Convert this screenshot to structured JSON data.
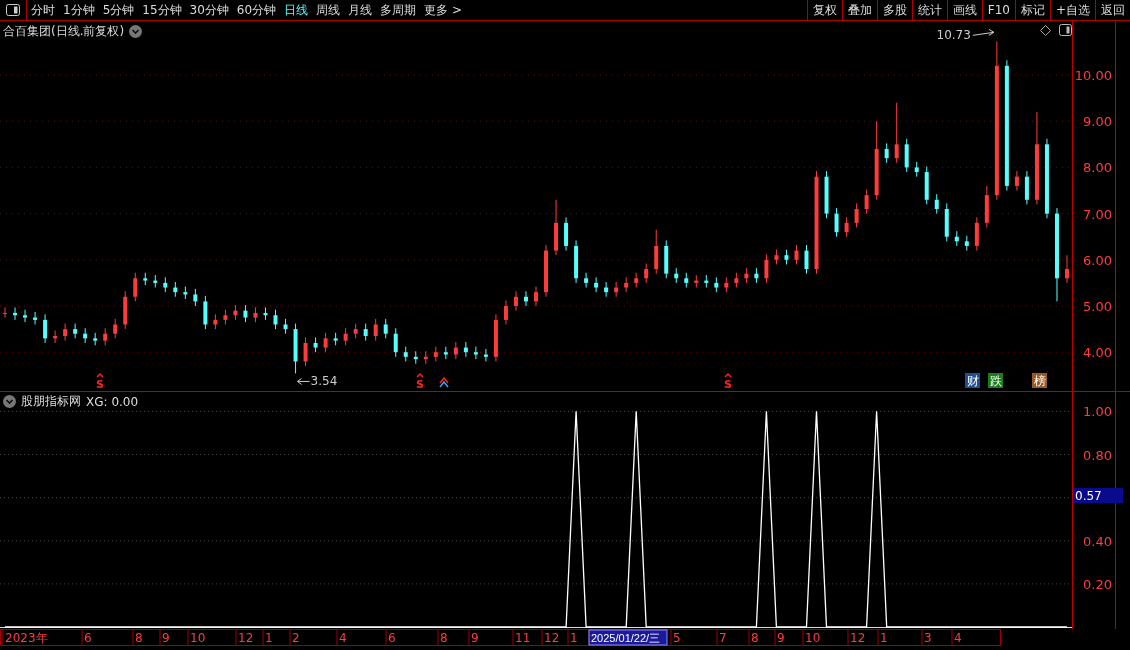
{
  "toolbar": {
    "periods": [
      {
        "label": "分时",
        "selected": false
      },
      {
        "label": "1分钟",
        "selected": false
      },
      {
        "label": "5分钟",
        "selected": false
      },
      {
        "label": "15分钟",
        "selected": false
      },
      {
        "label": "30分钟",
        "selected": false
      },
      {
        "label": "60分钟",
        "selected": false
      },
      {
        "label": "日线",
        "selected": true
      },
      {
        "label": "周线",
        "selected": false
      },
      {
        "label": "月线",
        "selected": false
      },
      {
        "label": "多周期",
        "selected": false
      },
      {
        "label": "更多 >",
        "selected": false
      }
    ],
    "buttons": [
      "复权",
      "叠加",
      "多股",
      "统计",
      "画线",
      "F10",
      "标记",
      "+自选",
      "返回"
    ]
  },
  "price_panel": {
    "title": "合百集团(日线.前复权)",
    "high_label": "10.73",
    "low_label": "3.54",
    "signals": [
      {
        "kind": "sell",
        "text": "S"
      },
      {
        "kind": "sell",
        "text": "S"
      },
      {
        "kind": "buy"
      },
      {
        "kind": "sell",
        "text": "S"
      }
    ],
    "badges": [
      {
        "text": "财",
        "color": "#1d4e8f"
      },
      {
        "text": "跌",
        "color": "#1b7d1b"
      },
      {
        "text": "榜",
        "color": "#9a5a22"
      }
    ],
    "chart_data": {
      "type": "candlestick",
      "grid": true,
      "ylim": [
        3.16,
        11.17
      ],
      "yticks": [
        {
          "value": 4,
          "label": "4.00"
        },
        {
          "value": 5,
          "label": "5.00"
        },
        {
          "value": 6,
          "label": "6.00"
        },
        {
          "value": 7,
          "label": "7.00"
        },
        {
          "value": 8,
          "label": "8.00"
        },
        {
          "value": 9,
          "label": "9.00"
        },
        {
          "value": 10,
          "label": "10.00"
        }
      ],
      "ohlc": [
        [
          4.85,
          4.97,
          4.75,
          4.85
        ],
        [
          4.85,
          4.97,
          4.7,
          4.8
        ],
        [
          4.8,
          4.92,
          4.65,
          4.75
        ],
        [
          4.75,
          4.87,
          4.6,
          4.7
        ],
        [
          4.7,
          4.82,
          4.2,
          4.3
        ],
        [
          4.3,
          4.47,
          4.2,
          4.35
        ],
        [
          4.35,
          4.62,
          4.25,
          4.5
        ],
        [
          4.5,
          4.62,
          4.3,
          4.4
        ],
        [
          4.4,
          4.52,
          4.2,
          4.3
        ],
        [
          4.3,
          4.42,
          4.15,
          4.25
        ],
        [
          4.25,
          4.52,
          4.15,
          4.4
        ],
        [
          4.4,
          4.72,
          4.3,
          4.6
        ],
        [
          4.6,
          5.32,
          4.5,
          5.2
        ],
        [
          5.2,
          5.72,
          5.1,
          5.6
        ],
        [
          5.6,
          5.72,
          5.45,
          5.55
        ],
        [
          5.55,
          5.67,
          5.4,
          5.5
        ],
        [
          5.5,
          5.62,
          5.3,
          5.4
        ],
        [
          5.4,
          5.52,
          5.2,
          5.3
        ],
        [
          5.3,
          5.42,
          5.15,
          5.25
        ],
        [
          5.25,
          5.37,
          5.0,
          5.1
        ],
        [
          5.1,
          5.22,
          4.5,
          4.6
        ],
        [
          4.6,
          4.82,
          4.5,
          4.7
        ],
        [
          4.7,
          4.92,
          4.6,
          4.8
        ],
        [
          4.8,
          5.02,
          4.7,
          4.9
        ],
        [
          4.9,
          5.02,
          4.65,
          4.75
        ],
        [
          4.75,
          4.97,
          4.65,
          4.85
        ],
        [
          4.85,
          4.97,
          4.7,
          4.8
        ],
        [
          4.8,
          4.92,
          4.5,
          4.6
        ],
        [
          4.6,
          4.72,
          4.4,
          4.5
        ],
        [
          4.5,
          4.62,
          3.54,
          3.8
        ],
        [
          3.8,
          4.32,
          3.7,
          4.2
        ],
        [
          4.2,
          4.32,
          4.0,
          4.1
        ],
        [
          4.1,
          4.42,
          4.0,
          4.3
        ],
        [
          4.3,
          4.42,
          4.15,
          4.25
        ],
        [
          4.25,
          4.52,
          4.15,
          4.4
        ],
        [
          4.4,
          4.62,
          4.3,
          4.5
        ],
        [
          4.5,
          4.62,
          4.25,
          4.35
        ],
        [
          4.35,
          4.72,
          4.25,
          4.6
        ],
        [
          4.6,
          4.72,
          4.3,
          4.4
        ],
        [
          4.4,
          4.52,
          3.9,
          4.0
        ],
        [
          4.0,
          4.12,
          3.8,
          3.9
        ],
        [
          3.9,
          4.02,
          3.75,
          3.85
        ],
        [
          3.85,
          4.02,
          3.75,
          3.9
        ],
        [
          3.9,
          4.12,
          3.8,
          4.0
        ],
        [
          4.0,
          4.12,
          3.85,
          3.95
        ],
        [
          3.95,
          4.22,
          3.85,
          4.1
        ],
        [
          4.1,
          4.22,
          3.9,
          4.0
        ],
        [
          4.0,
          4.12,
          3.85,
          3.95
        ],
        [
          3.95,
          4.07,
          3.8,
          3.9
        ],
        [
          3.9,
          4.82,
          3.8,
          4.7
        ],
        [
          4.7,
          5.12,
          4.6,
          5.0
        ],
        [
          5.0,
          5.32,
          4.9,
          5.2
        ],
        [
          5.2,
          5.32,
          5.0,
          5.1
        ],
        [
          5.1,
          5.42,
          5.0,
          5.3
        ],
        [
          5.3,
          6.32,
          5.2,
          6.2
        ],
        [
          6.2,
          7.3,
          6.1,
          6.8
        ],
        [
          6.8,
          6.92,
          6.2,
          6.3
        ],
        [
          6.3,
          6.42,
          5.5,
          5.6
        ],
        [
          5.6,
          5.72,
          5.4,
          5.5
        ],
        [
          5.5,
          5.62,
          5.3,
          5.4
        ],
        [
          5.4,
          5.52,
          5.2,
          5.3
        ],
        [
          5.3,
          5.52,
          5.2,
          5.4
        ],
        [
          5.4,
          5.62,
          5.3,
          5.5
        ],
        [
          5.5,
          5.72,
          5.4,
          5.6
        ],
        [
          5.6,
          5.92,
          5.5,
          5.8
        ],
        [
          5.8,
          6.65,
          5.7,
          6.3
        ],
        [
          6.3,
          6.42,
          5.6,
          5.7
        ],
        [
          5.7,
          5.82,
          5.5,
          5.6
        ],
        [
          5.6,
          5.72,
          5.4,
          5.5
        ],
        [
          5.5,
          5.67,
          5.4,
          5.55
        ],
        [
          5.55,
          5.67,
          5.4,
          5.5
        ],
        [
          5.5,
          5.62,
          5.3,
          5.4
        ],
        [
          5.4,
          5.62,
          5.3,
          5.5
        ],
        [
          5.5,
          5.72,
          5.4,
          5.6
        ],
        [
          5.6,
          5.82,
          5.5,
          5.7
        ],
        [
          5.7,
          5.82,
          5.5,
          5.6
        ],
        [
          5.6,
          6.12,
          5.5,
          6.0
        ],
        [
          6.0,
          6.22,
          5.9,
          6.1
        ],
        [
          6.1,
          6.22,
          5.9,
          6.0
        ],
        [
          6.0,
          6.32,
          5.9,
          6.2
        ],
        [
          6.2,
          6.32,
          5.7,
          5.8
        ],
        [
          5.8,
          7.92,
          5.7,
          7.8
        ],
        [
          7.8,
          7.92,
          6.9,
          7.0
        ],
        [
          7.0,
          7.12,
          6.5,
          6.6
        ],
        [
          6.6,
          6.92,
          6.5,
          6.8
        ],
        [
          6.8,
          7.22,
          6.7,
          7.1
        ],
        [
          7.1,
          7.52,
          7.0,
          7.4
        ],
        [
          7.4,
          9.0,
          7.3,
          8.4
        ],
        [
          8.4,
          8.52,
          8.1,
          8.2
        ],
        [
          8.2,
          9.4,
          8.1,
          8.5
        ],
        [
          8.5,
          8.62,
          7.9,
          8.0
        ],
        [
          8.0,
          8.12,
          7.8,
          7.9
        ],
        [
          7.9,
          8.02,
          7.2,
          7.3
        ],
        [
          7.3,
          7.42,
          7.0,
          7.1
        ],
        [
          7.1,
          7.22,
          6.4,
          6.5
        ],
        [
          6.5,
          6.62,
          6.3,
          6.4
        ],
        [
          6.4,
          6.52,
          6.2,
          6.3
        ],
        [
          6.3,
          6.92,
          6.2,
          6.8
        ],
        [
          6.8,
          7.6,
          6.7,
          7.4
        ],
        [
          7.4,
          10.73,
          7.3,
          10.2
        ],
        [
          10.2,
          10.32,
          7.5,
          7.6
        ],
        [
          7.6,
          7.92,
          7.5,
          7.8
        ],
        [
          7.8,
          7.92,
          7.2,
          7.3
        ],
        [
          7.3,
          9.2,
          7.2,
          8.5
        ],
        [
          8.5,
          8.62,
          6.9,
          7.0
        ],
        [
          7.0,
          7.12,
          5.1,
          5.6
        ],
        [
          5.6,
          6.1,
          5.5,
          5.8
        ]
      ]
    }
  },
  "indicator_panel": {
    "title": "股朋指标网",
    "reading": "XG: 0.00",
    "cursor_value": "0.57",
    "chart_data": {
      "type": "line",
      "grid": true,
      "ylim": [
        0,
        1.09
      ],
      "yticks": [
        {
          "value": 0.2,
          "label": "0.20"
        },
        {
          "value": 0.4,
          "label": "0.40"
        },
        {
          "value": 0.8,
          "label": "0.80"
        },
        {
          "value": 1,
          "label": "1.00"
        }
      ],
      "series": [
        {
          "color": "#ffffff",
          "values": [
            0,
            0,
            0,
            0,
            0,
            0,
            0,
            0,
            0,
            0,
            0,
            0,
            0,
            0,
            0,
            0,
            0,
            0,
            0,
            0,
            0,
            0,
            0,
            0,
            0,
            0,
            0,
            0,
            0,
            0,
            0,
            0,
            0,
            0,
            0,
            0,
            0,
            0,
            0,
            0,
            0,
            0,
            0,
            0,
            0,
            0,
            0,
            0,
            0,
            0,
            0,
            0,
            0,
            0,
            0,
            0,
            0,
            1,
            0,
            0,
            0,
            0,
            0,
            1,
            0,
            0,
            0,
            0,
            0,
            0,
            0,
            0,
            0,
            0,
            0,
            0,
            1,
            0,
            0,
            0,
            0,
            1,
            0,
            0,
            0,
            0,
            0,
            1,
            0,
            0,
            0,
            0,
            0,
            0,
            0,
            0,
            0,
            0,
            0,
            0,
            0,
            0,
            0,
            0,
            0,
            0,
            0
          ]
        }
      ]
    }
  },
  "date_axis": [
    {
      "label": "2023年",
      "selected": false
    },
    {
      "label": "6",
      "selected": false
    },
    {
      "label": "8",
      "selected": false
    },
    {
      "label": "9",
      "selected": false
    },
    {
      "label": "10",
      "selected": false
    },
    {
      "label": "12",
      "selected": false
    },
    {
      "label": "1",
      "selected": false
    },
    {
      "label": "2",
      "selected": false
    },
    {
      "label": "4",
      "selected": false
    },
    {
      "label": "6",
      "selected": false
    },
    {
      "label": "8",
      "selected": false
    },
    {
      "label": "9",
      "selected": false
    },
    {
      "label": "11",
      "selected": false
    },
    {
      "label": "12",
      "selected": false
    },
    {
      "label": "1",
      "selected": false
    },
    {
      "label": "2025/01/22/三",
      "selected": true
    },
    {
      "label": "5",
      "selected": false
    },
    {
      "label": "7",
      "selected": false
    },
    {
      "label": "8",
      "selected": false
    },
    {
      "label": "9",
      "selected": false
    },
    {
      "label": "10",
      "selected": false
    },
    {
      "label": "12",
      "selected": false
    },
    {
      "label": "1",
      "selected": false
    },
    {
      "label": "3",
      "selected": false
    },
    {
      "label": "4",
      "selected": false
    }
  ]
}
